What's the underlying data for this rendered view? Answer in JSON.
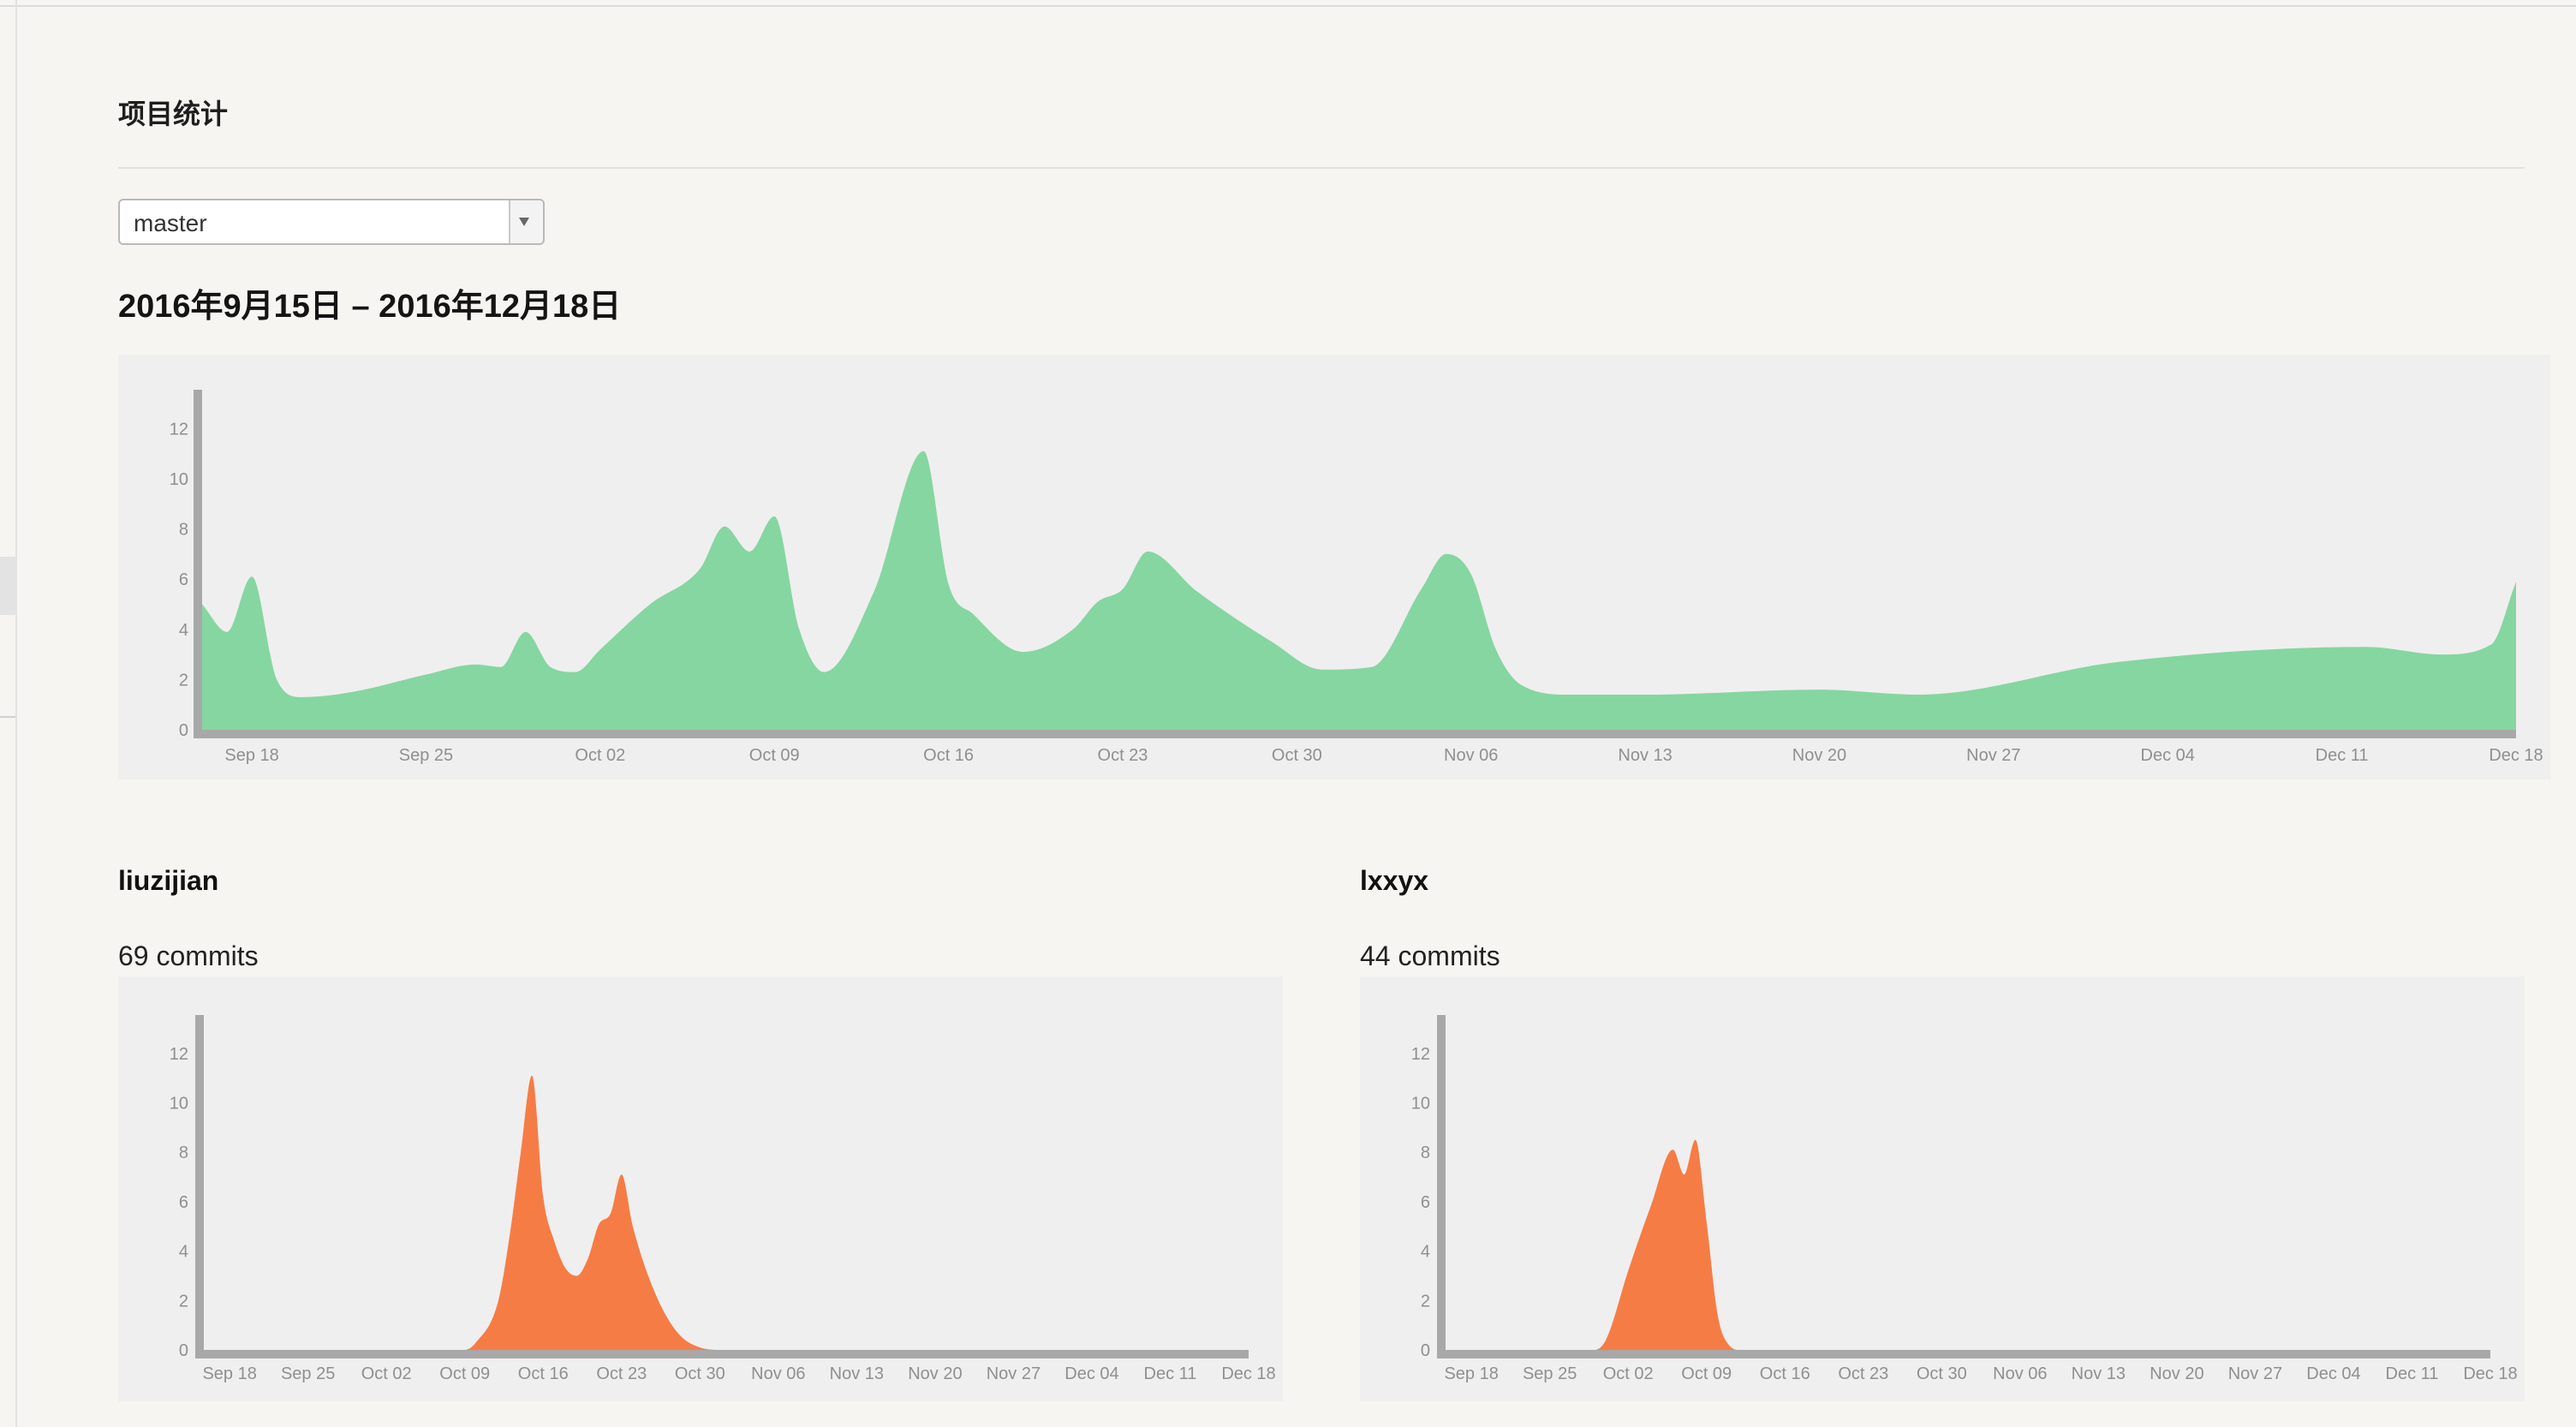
{
  "page": {
    "title": "项目统计",
    "branch_select": {
      "value": "master"
    },
    "date_range": "2016年9月15日 – 2016年12月18日"
  },
  "contributors": [
    {
      "name": "liuzijian",
      "commits_label": "69 commits"
    },
    {
      "name": "lxxyx",
      "commits_label": "44 commits"
    }
  ],
  "colors": {
    "total_area": "#86d6a1",
    "contributor_area": "#f67c45",
    "axis": "#a8a8a8",
    "tick_text": "#8f8f8f"
  },
  "chart_data": [
    {
      "type": "area",
      "title": "",
      "y_ticks": [
        0,
        2,
        4,
        6,
        8,
        10,
        12
      ],
      "x_ticks": [
        "Sep 18",
        "Sep 25",
        "Oct 02",
        "Oct 09",
        "Oct 16",
        "Oct 23",
        "Oct 30",
        "Nov 06",
        "Nov 13",
        "Nov 20",
        "Nov 27",
        "Dec 04",
        "Dec 11",
        "Dec 18"
      ],
      "ylim": [
        0,
        13
      ],
      "x_range": [
        "2016-09-16",
        "2016-12-18"
      ],
      "series": [
        {
          "points": [
            [
              "2016-09-16",
              5.0
            ],
            [
              "2016-09-17",
              3.9
            ],
            [
              "2016-09-18",
              6.1
            ],
            [
              "2016-09-19",
              2.0
            ],
            [
              "2016-09-20",
              1.3
            ],
            [
              "2016-09-22",
              1.5
            ],
            [
              "2016-09-25",
              2.2
            ],
            [
              "2016-09-27",
              2.6
            ],
            [
              "2016-09-28",
              2.5
            ],
            [
              "2016-09-29",
              3.9
            ],
            [
              "2016-09-30",
              2.5
            ],
            [
              "2016-10-01",
              2.3
            ],
            [
              "2016-10-02",
              3.2
            ],
            [
              "2016-10-04",
              5.0
            ],
            [
              "2016-10-06",
              6.4
            ],
            [
              "2016-10-07",
              8.1
            ],
            [
              "2016-10-08",
              7.1
            ],
            [
              "2016-10-09",
              8.5
            ],
            [
              "2016-10-10",
              4.0
            ],
            [
              "2016-10-11",
              2.3
            ],
            [
              "2016-10-13",
              5.5
            ],
            [
              "2016-10-15",
              11.1
            ],
            [
              "2016-10-16",
              5.8
            ],
            [
              "2016-10-17",
              4.6
            ],
            [
              "2016-10-19",
              3.1
            ],
            [
              "2016-10-21",
              4.0
            ],
            [
              "2016-10-22",
              5.1
            ],
            [
              "2016-10-23",
              5.6
            ],
            [
              "2016-10-24",
              7.1
            ],
            [
              "2016-10-26",
              5.5
            ],
            [
              "2016-10-29",
              3.5
            ],
            [
              "2016-10-31",
              2.4
            ],
            [
              "2016-11-02",
              2.5
            ],
            [
              "2016-11-04",
              5.6
            ],
            [
              "2016-11-05",
              7.0
            ],
            [
              "2016-11-06",
              6.2
            ],
            [
              "2016-11-07",
              3.2
            ],
            [
              "2016-11-08",
              1.8
            ],
            [
              "2016-11-10",
              1.4
            ],
            [
              "2016-11-13",
              1.4
            ],
            [
              "2016-11-20",
              1.6
            ],
            [
              "2016-11-24",
              1.4
            ],
            [
              "2016-12-02",
              2.7
            ],
            [
              "2016-12-12",
              3.3
            ],
            [
              "2016-12-15",
              3.0
            ],
            [
              "2016-12-17",
              3.4
            ],
            [
              "2016-12-18",
              5.9
            ]
          ]
        }
      ]
    },
    {
      "type": "area",
      "title": "",
      "y_ticks": [
        0,
        2,
        4,
        6,
        8,
        10,
        12
      ],
      "x_ticks": [
        "Sep 18",
        "Sep 25",
        "Oct 02",
        "Oct 09",
        "Oct 16",
        "Oct 23",
        "Oct 30",
        "Nov 06",
        "Nov 13",
        "Nov 20",
        "Nov 27",
        "Dec 04",
        "Dec 11",
        "Dec 18"
      ],
      "ylim": [
        0,
        13
      ],
      "x_range": [
        "2016-09-16",
        "2016-12-18"
      ],
      "series": [
        {
          "points": [
            [
              "2016-09-16",
              0
            ],
            [
              "2016-10-09",
              0
            ],
            [
              "2016-10-10",
              0.3
            ],
            [
              "2016-10-12",
              2.0
            ],
            [
              "2016-10-13",
              4.6
            ],
            [
              "2016-10-14",
              8.0
            ],
            [
              "2016-10-15",
              11.1
            ],
            [
              "2016-10-16",
              6.2
            ],
            [
              "2016-10-17",
              4.4
            ],
            [
              "2016-10-18",
              3.3
            ],
            [
              "2016-10-19",
              3.0
            ],
            [
              "2016-10-20",
              3.7
            ],
            [
              "2016-10-21",
              5.1
            ],
            [
              "2016-10-22",
              5.5
            ],
            [
              "2016-10-23",
              7.1
            ],
            [
              "2016-10-24",
              5.0
            ],
            [
              "2016-10-26",
              2.3
            ],
            [
              "2016-10-28",
              0.7
            ],
            [
              "2016-10-30",
              0.1
            ],
            [
              "2016-11-01",
              0
            ],
            [
              "2016-12-18",
              0
            ]
          ]
        }
      ]
    },
    {
      "type": "area",
      "title": "",
      "y_ticks": [
        0,
        2,
        4,
        6,
        8,
        10,
        12
      ],
      "x_ticks": [
        "Sep 18",
        "Sep 25",
        "Oct 02",
        "Oct 09",
        "Oct 16",
        "Oct 23",
        "Oct 30",
        "Nov 06",
        "Nov 13",
        "Nov 20",
        "Nov 27",
        "Dec 04",
        "Dec 11",
        "Dec 18"
      ],
      "ylim": [
        0,
        13
      ],
      "x_range": [
        "2016-09-16",
        "2016-12-18"
      ],
      "series": [
        {
          "points": [
            [
              "2016-09-16",
              0
            ],
            [
              "2016-09-29",
              0
            ],
            [
              "2016-09-30",
              0.4
            ],
            [
              "2016-10-02",
              3.2
            ],
            [
              "2016-10-04",
              5.8
            ],
            [
              "2016-10-06",
              8.1
            ],
            [
              "2016-10-07",
              7.1
            ],
            [
              "2016-10-08",
              8.5
            ],
            [
              "2016-10-09",
              5.2
            ],
            [
              "2016-10-10",
              1.4
            ],
            [
              "2016-10-11",
              0.2
            ],
            [
              "2016-10-12",
              0
            ],
            [
              "2016-12-18",
              0
            ]
          ]
        }
      ]
    }
  ]
}
